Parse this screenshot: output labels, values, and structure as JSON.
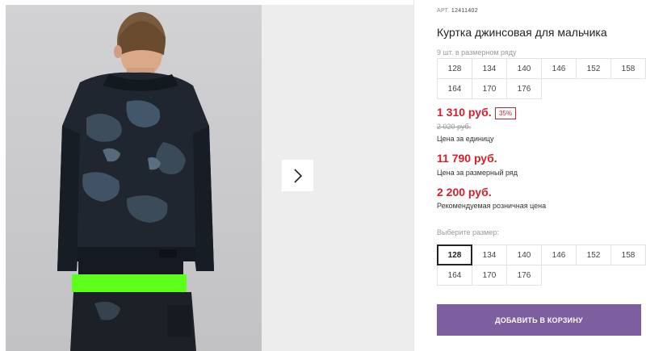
{
  "product": {
    "article_label": "АРТ.",
    "article": "12411402",
    "title": "Куртка джинсовая для мальчика"
  },
  "pack": {
    "note": "9 шт. в размерном ряду",
    "sizes": [
      "128",
      "134",
      "140",
      "146",
      "152",
      "158",
      "164",
      "170",
      "176"
    ]
  },
  "price": {
    "unit_price": "1 310 руб.",
    "discount": "35%",
    "old_price": "2 020 руб.",
    "unit_label": "Цена за единицу",
    "pack_price": "11 790 руб.",
    "pack_label": "Цена за размерный ряд",
    "rrp_price": "2 200 руб.",
    "rrp_label": "Рекомендуемая розничная цена"
  },
  "size_selector": {
    "label": "Выберите размер:",
    "selected": "128",
    "sizes": [
      "128",
      "134",
      "140",
      "146",
      "152",
      "158",
      "164",
      "170",
      "176"
    ]
  },
  "cart_button": {
    "label": "ДОБАВИТЬ В КОРЗИНУ"
  },
  "colors": {
    "price": "#d4202a",
    "cart_button": "#7d5e9e",
    "accent_shirt": "#5cff1a"
  },
  "icons": {
    "next": "chevron-right-icon"
  }
}
